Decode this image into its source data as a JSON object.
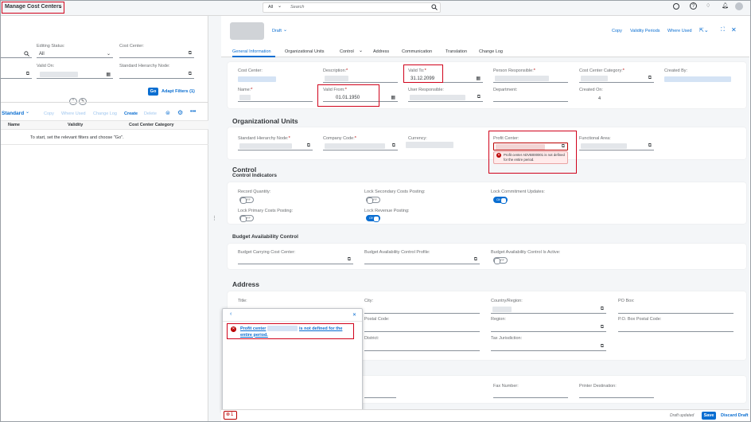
{
  "shell": {
    "app_title": "Manage Cost Centers",
    "search_scope": "All",
    "search_placeholder": "Search",
    "colors": {
      "accent": "#0a6ed1",
      "error": "#bb0000",
      "shell_bg": "#f4f6f8"
    }
  },
  "filters": {
    "editing_status_label": "Editing Status:",
    "editing_status_value": "All",
    "cost_center_label": "Cost Center:",
    "valid_on_label": "Valid On:",
    "std_hierarchy_label": "Standard Hierarchy Node:",
    "go": "Go",
    "adapt_filters": "Adapt Filters (1)"
  },
  "list": {
    "variant": "Standard",
    "copy": "Copy",
    "where_used": "Where Used",
    "change_log": "Change Log",
    "create": "Create",
    "delete": "Delete",
    "col_name": "Name",
    "col_validity": "Validity",
    "col_category": "Cost Center Category",
    "empty_text": "To start, set the relevant filters and choose \"Go\"."
  },
  "object": {
    "status": "Draft",
    "actions": {
      "copy": "Copy",
      "validity_periods": "Validity Periods",
      "where_used": "Where Used"
    },
    "tabs": [
      "General Information",
      "Organizational Units",
      "Control",
      "Address",
      "Communication",
      "Translation",
      "Change Log"
    ]
  },
  "general": {
    "cost_center": "Cost Center:",
    "description": "Description:",
    "valid_to": "Valid To:",
    "valid_to_value": "31.12.2099",
    "person_responsible": "Person Responsible:",
    "cost_center_category": "Cost Center Category:",
    "created_by": "Created By:",
    "name": "Name:",
    "valid_from": "Valid From:",
    "valid_from_value": "01.01.1950",
    "user_responsible": "User Responsible:",
    "department": "Department:",
    "created_on": "Created On:",
    "created_on_value": "4"
  },
  "org_units": {
    "title": "Organizational Units",
    "std_hierarchy_node": "Standard Hierarchy Node:",
    "company_code": "Company Code:",
    "currency": "Currency:",
    "profit_center": "Profit Center:",
    "functional_area": "Functional Area:",
    "error_text": "Profit center ADVB000001 is not defined for the entire period."
  },
  "control": {
    "title": "Control",
    "indicators_title": "Control Indicators",
    "record_quantity": "Record Quantity:",
    "lock_secondary": "Lock Secondary Costs Posting:",
    "lock_commitment": "Lock Commitment Updates:",
    "lock_primary": "Lock Primary Costs Posting:",
    "lock_revenue": "Lock Revenue Posting:",
    "off": "OFF",
    "on": "ON"
  },
  "budget": {
    "title": "Budget Availability Control",
    "carrying": "Budget Carrying Cost Center:",
    "profile": "Budget Availability Control Profile:",
    "active": "Budget Availability Control Is Active:"
  },
  "address": {
    "title": "Address",
    "title_field": "Title:",
    "city": "City:",
    "country": "Country/Region:",
    "po_box": "PO Box:",
    "postal_code": "Postal Code:",
    "region": "Region:",
    "po_box_postal": "P.O. Box Postal Code:",
    "district": "District:",
    "tax_jurisdiction": "Tax Jurisdiction:"
  },
  "communication": {
    "fax": "Fax Number:",
    "printer": "Printer Destination:"
  },
  "message_popover": {
    "pre": "Profit center",
    "post": "is not defined for the entire period."
  },
  "footer": {
    "error_count": "1",
    "draft_updated": "Draft updated",
    "save": "Save",
    "discard": "Discard Draft"
  }
}
